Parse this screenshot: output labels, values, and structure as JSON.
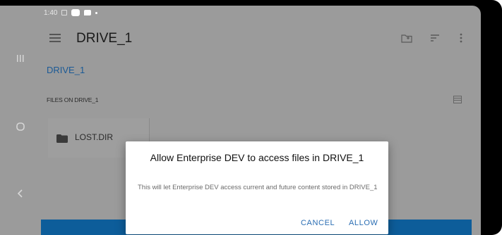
{
  "status_bar": {
    "time": "1:40"
  },
  "app_bar": {
    "title": "DRIVE_1"
  },
  "breadcrumb": "DRIVE_1",
  "section_label": "FILES ON DRIVE_1",
  "files": [
    {
      "name": "LOST.DIR",
      "icon": "folder-icon"
    }
  ],
  "dialog": {
    "title": "Allow Enterprise DEV to access files in DRIVE_1",
    "body": "This will let Enterprise DEV access current and future content stored in DRIVE_1",
    "cancel_label": "CANCEL",
    "allow_label": "ALLOW"
  },
  "colors": {
    "accent": "#2a6db3",
    "breadcrumb": "#1b5a96",
    "bottom_bar": "#0d5d9a",
    "scrim_background": "#9b9b9b"
  }
}
